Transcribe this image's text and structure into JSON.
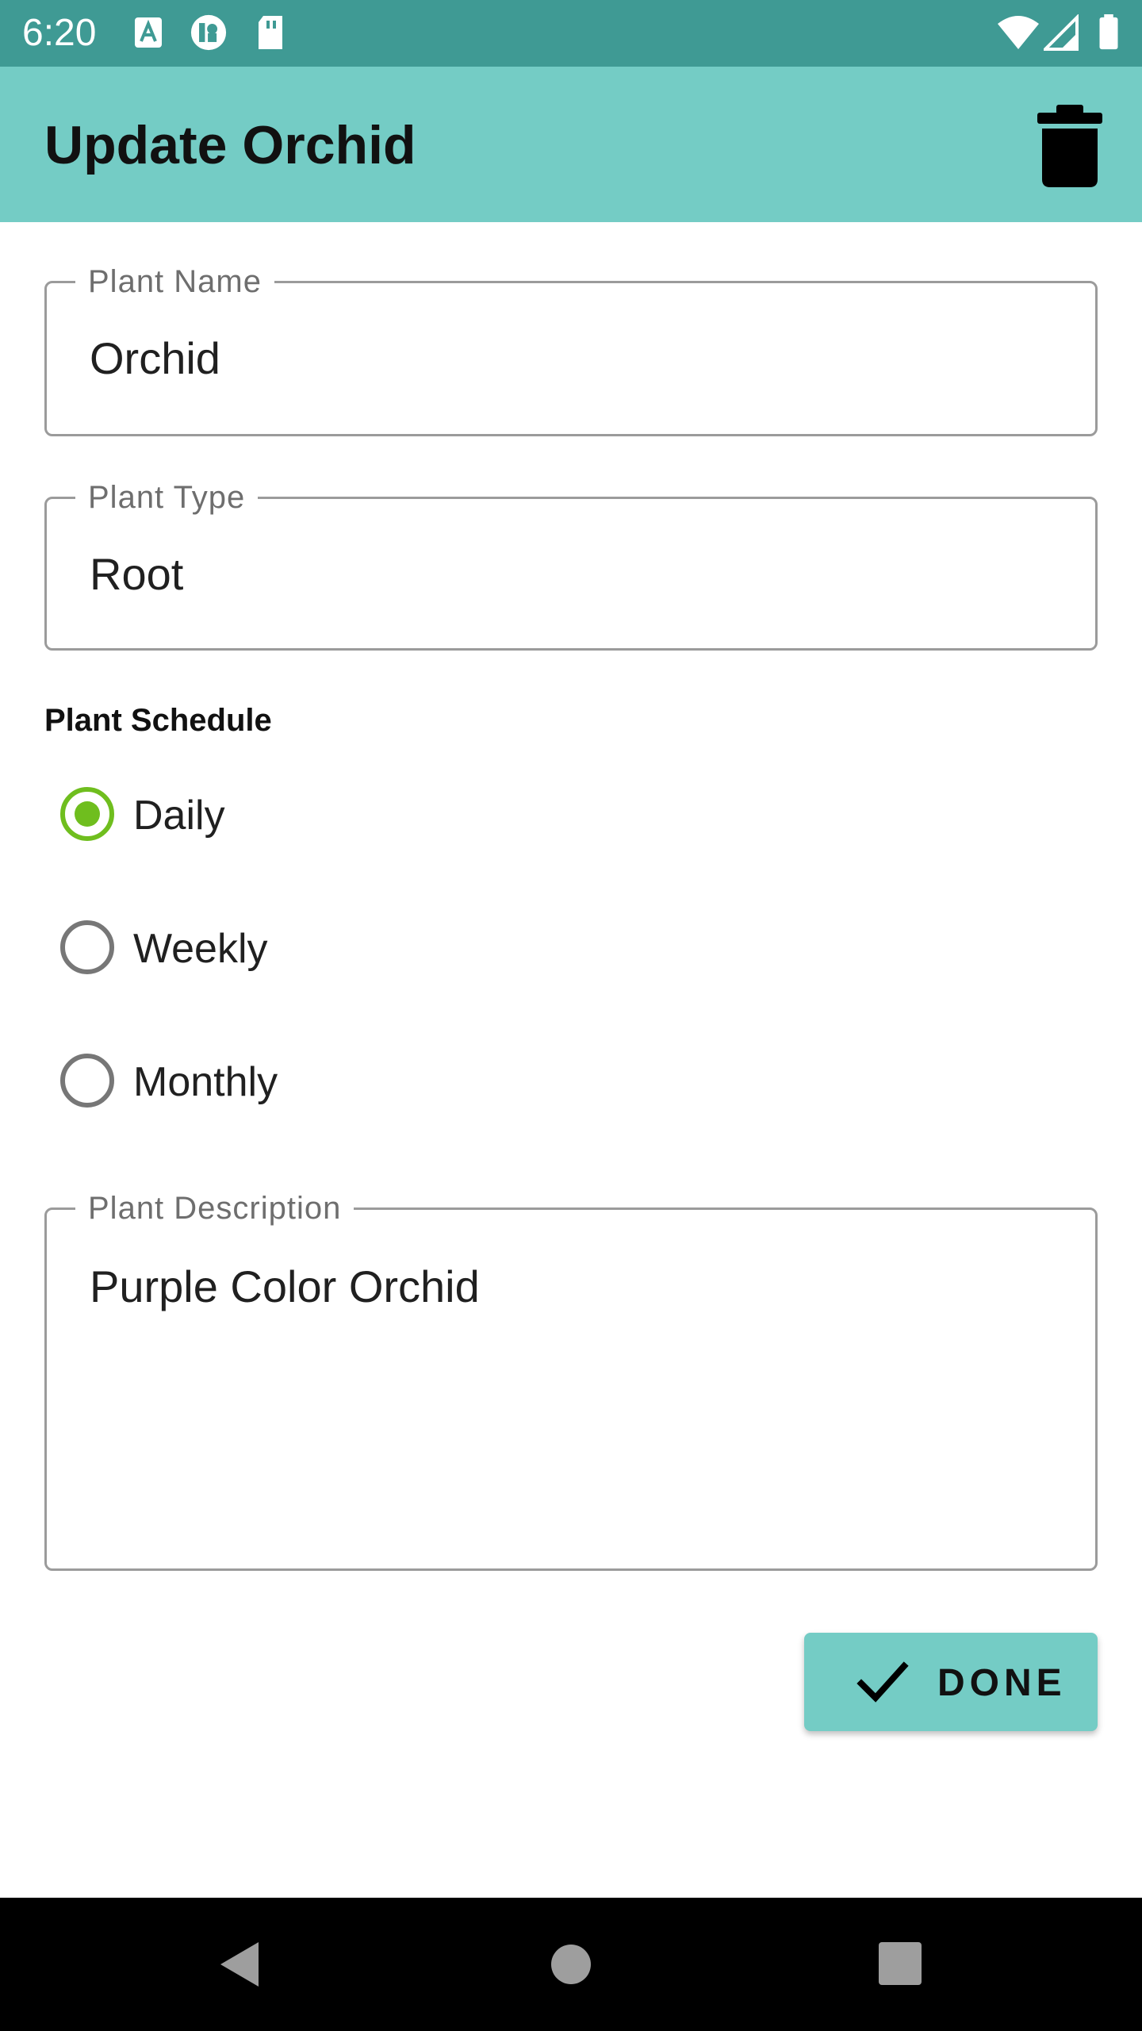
{
  "status_bar": {
    "time": "6:20",
    "left_icons": [
      "a-box-icon",
      "circle-badge-icon",
      "sd-card-icon"
    ],
    "right_icons": [
      "wifi-icon",
      "cell-signal-icon",
      "battery-icon"
    ]
  },
  "app_bar": {
    "title": "Update Orchid",
    "delete_icon": "trash-icon",
    "background_color": "#74ccc5"
  },
  "form": {
    "plant_name": {
      "label": "Plant Name",
      "value": "Orchid"
    },
    "plant_type": {
      "label": "Plant Type",
      "value": "Root"
    },
    "schedule": {
      "title": "Plant Schedule",
      "options": [
        {
          "label": "Daily",
          "checked": true
        },
        {
          "label": "Weekly",
          "checked": false
        },
        {
          "label": "Monthly",
          "checked": false
        }
      ],
      "accent_color": "#6fbe1e"
    },
    "plant_description": {
      "label": "Plant Description",
      "value": "Purple Color Orchid"
    }
  },
  "done_button": {
    "label": "DONE",
    "icon": "check-icon"
  },
  "nav_bar": {
    "icons": [
      "back-icon",
      "home-icon",
      "recents-icon"
    ]
  }
}
